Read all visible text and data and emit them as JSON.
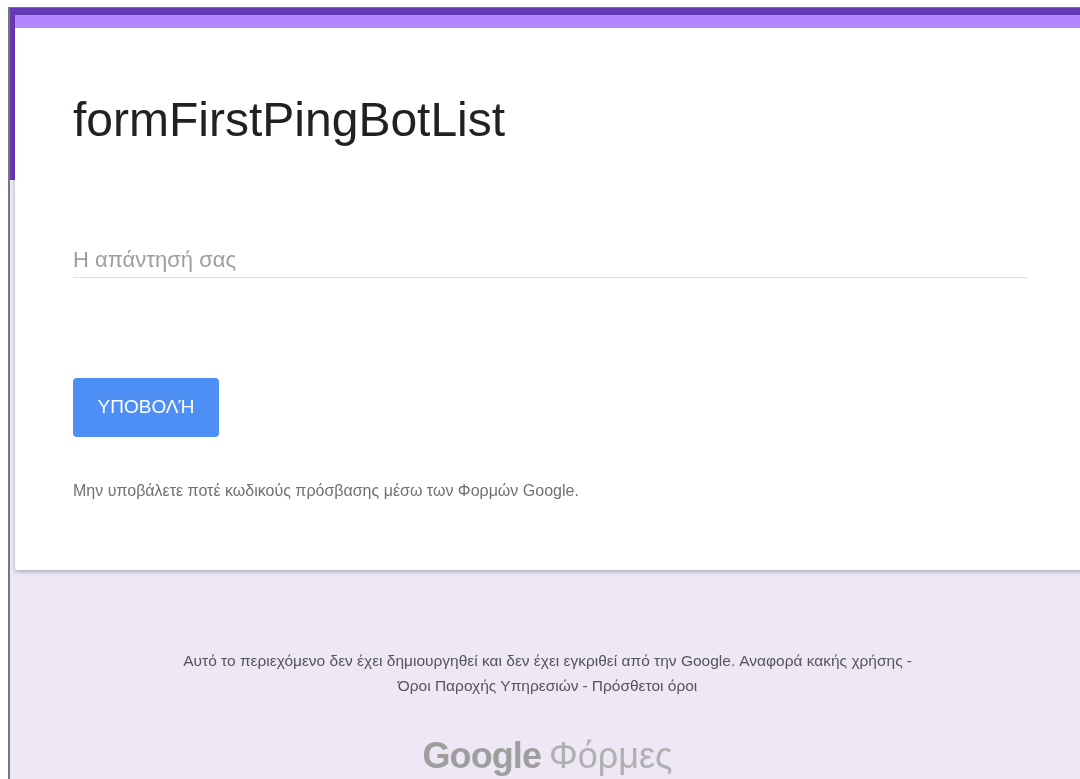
{
  "form": {
    "title": "formFirstPingBotList",
    "answer": {
      "placeholder": "Η απάντησή σας"
    },
    "submit": "ΥΠΟΒΟΛΉ",
    "warning": "Μην υποβάλετε ποτέ κωδικούς πρόσβασης μέσω των Φορμών Google."
  },
  "footer": {
    "notice": "Αυτό το περιεχόμενο δεν έχει δημιουργηθεί και δεν έχει εγκριθεί από την Google.",
    "separator": "-",
    "links": [
      "Αναφορά κακής χρήσης",
      "Όροι Παροχής Υπηρεσιών",
      "Πρόσθετοι όροι"
    ]
  },
  "logo": {
    "brand": "Google",
    "product": "Φόρμες"
  }
}
